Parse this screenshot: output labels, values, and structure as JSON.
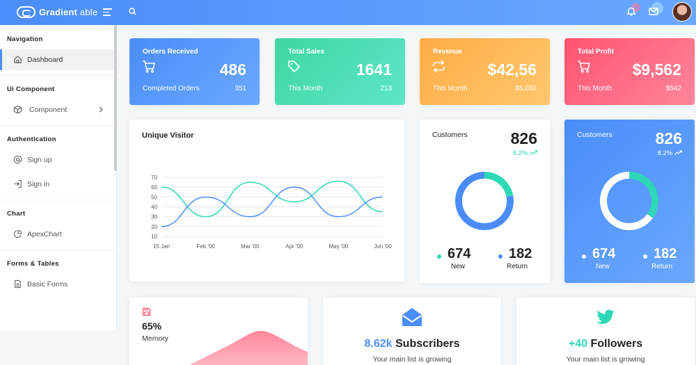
{
  "header": {
    "brand_bold": "Gradient",
    "brand_light": " able"
  },
  "sidebar": {
    "sections": [
      {
        "title": "Navigation",
        "items": [
          {
            "label": "Dashboard",
            "icon": "home-icon",
            "active": true
          }
        ]
      },
      {
        "title": "Ui Component",
        "items": [
          {
            "label": "Component",
            "icon": "box-icon",
            "has_submenu": true
          }
        ]
      },
      {
        "title": "Authentication",
        "items": [
          {
            "label": "Sign up",
            "icon": "at-icon"
          },
          {
            "label": "Sign in",
            "icon": "login-icon"
          }
        ]
      },
      {
        "title": "Chart",
        "items": [
          {
            "label": "ApexChart",
            "icon": "pie-chart-icon"
          }
        ]
      },
      {
        "title": "Forms & Tables",
        "items": [
          {
            "label": "Basic Forms",
            "icon": "file-text-icon"
          }
        ]
      }
    ]
  },
  "stats": [
    {
      "title": "Orders Received",
      "value": "486",
      "sub_label": "Completed Orders",
      "sub_value": "351",
      "icon": "cart-icon"
    },
    {
      "title": "Total Sales",
      "value": "1641",
      "sub_label": "This Month",
      "sub_value": "213",
      "icon": "tag-icon"
    },
    {
      "title": "Revenue",
      "value": "$42,56",
      "sub_label": "This Month",
      "sub_value": "$5,032",
      "icon": "repeat-icon"
    },
    {
      "title": "Total Profit",
      "value": "$9,562",
      "sub_label": "This Month",
      "sub_value": "$542",
      "icon": "cart-icon"
    }
  ],
  "colors": {
    "blue": "#4a8dfa",
    "green": "#2ed8b6",
    "orange": "#ffb64d",
    "red": "#ff5370"
  },
  "chart_data": {
    "type": "line",
    "title": "Unique Visitor",
    "x": [
      "15 Jan",
      "Feb '00",
      "Mar '00",
      "Apr '00",
      "May '00",
      "Jun '00"
    ],
    "ylim": [
      10,
      70
    ],
    "yticks": [
      10,
      20,
      30,
      40,
      50,
      60,
      70
    ],
    "grid": true,
    "series": [
      {
        "color": "#2ed8b6",
        "values": [
          60,
          30,
          65,
          45,
          66,
          35
        ]
      },
      {
        "color": "#4a8dfa",
        "values": [
          20,
          50,
          30,
          60,
          30,
          50
        ]
      }
    ]
  },
  "customers": [
    {
      "label": "Customers",
      "value": "826",
      "change": "8.2%",
      "new_value": "674",
      "new_label": "New",
      "return_value": "182",
      "return_label": "Return",
      "new_fraction": 0.22
    },
    {
      "label": "Customers",
      "value": "826",
      "change": "8.2%",
      "new_value": "674",
      "new_label": "New",
      "return_value": "182",
      "return_label": "Return",
      "new_fraction": 0.35
    }
  ],
  "memory": {
    "percent": "65%",
    "label": "Memory",
    "icon": "save-icon"
  },
  "subscribers": {
    "count": "8.62k",
    "label": "Subscribers",
    "sub": "Your main list is growing",
    "icon": "mail-open-icon"
  },
  "followers": {
    "count": "+40",
    "label": "Followers",
    "sub": "Your main list is growing",
    "icon": "twitter-icon"
  }
}
